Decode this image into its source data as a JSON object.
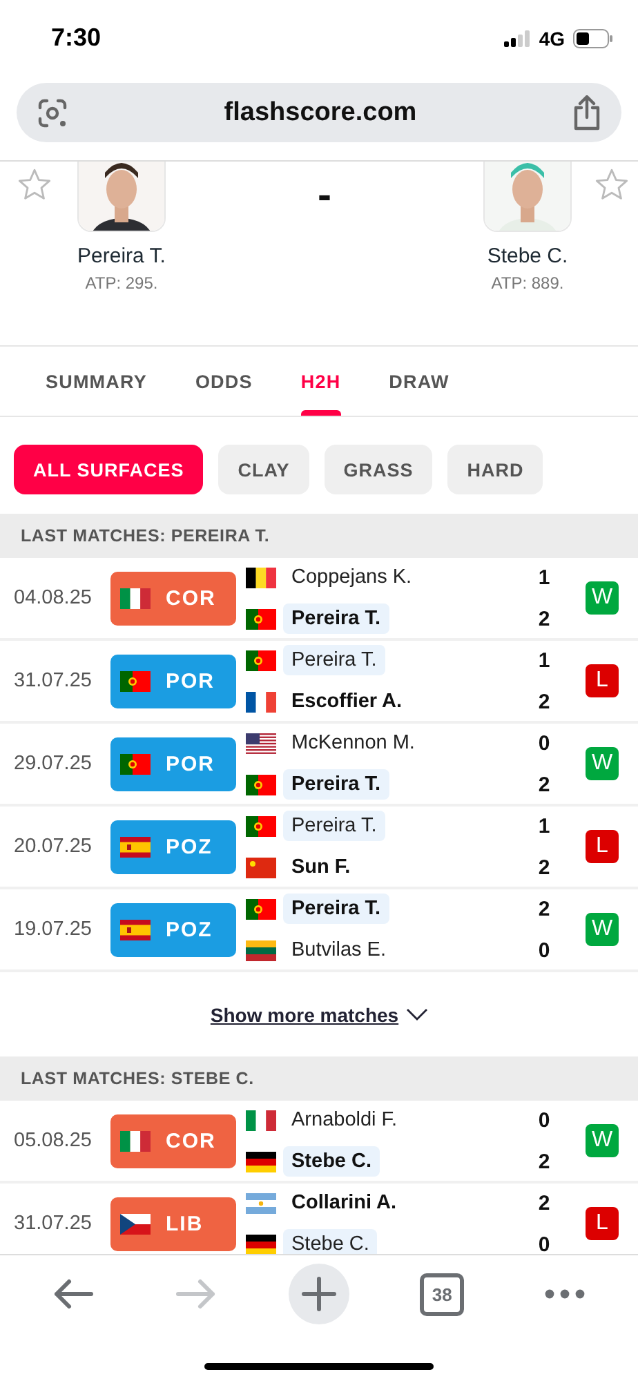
{
  "status_bar": {
    "time": "7:30",
    "network": "4G"
  },
  "address_bar": {
    "url": "flashscore.com"
  },
  "match": {
    "score": "-",
    "players": [
      {
        "name": "Pereira T.",
        "rank": "ATP: 295.",
        "favorite": false
      },
      {
        "name": "Stebe C.",
        "rank": "ATP: 889.",
        "favorite": false
      }
    ]
  },
  "tabs": [
    {
      "label": "SUMMARY",
      "selected": false
    },
    {
      "label": "ODDS",
      "selected": false
    },
    {
      "label": "H2H",
      "selected": true
    },
    {
      "label": "DRAW",
      "selected": false
    }
  ],
  "surface_filters": [
    {
      "label": "ALL SURFACES",
      "selected": true
    },
    {
      "label": "CLAY",
      "selected": false
    },
    {
      "label": "GRASS",
      "selected": false
    },
    {
      "label": "HARD",
      "selected": false
    }
  ],
  "sections": [
    {
      "title": "LAST MATCHES: PEREIRA T.",
      "show_more": "Show more matches",
      "rows": [
        {
          "date": "04.08.25",
          "tournament": {
            "code": "COR",
            "kind": "it",
            "color": "#ef6342"
          },
          "players": [
            {
              "name": "Coppejans K.",
              "kind": "be",
              "score": "1",
              "winner": false,
              "highlighted": false
            },
            {
              "name": "Pereira T.",
              "kind": "pt",
              "score": "2",
              "winner": true,
              "highlighted": true
            }
          ],
          "result": {
            "label": "W",
            "color": "#00a83f"
          }
        },
        {
          "date": "31.07.25",
          "tournament": {
            "code": "POR",
            "kind": "pt",
            "color": "#1b9de2"
          },
          "players": [
            {
              "name": "Pereira T.",
              "kind": "pt",
              "score": "1",
              "winner": false,
              "highlighted": true
            },
            {
              "name": "Escoffier A.",
              "kind": "fr",
              "score": "2",
              "winner": true,
              "highlighted": false
            }
          ],
          "result": {
            "label": "L",
            "color": "#dc0000"
          }
        },
        {
          "date": "29.07.25",
          "tournament": {
            "code": "POR",
            "kind": "pt",
            "color": "#1b9de2"
          },
          "players": [
            {
              "name": "McKennon M.",
              "kind": "us",
              "score": "0",
              "winner": false,
              "highlighted": false
            },
            {
              "name": "Pereira T.",
              "kind": "pt",
              "score": "2",
              "winner": true,
              "highlighted": true
            }
          ],
          "result": {
            "label": "W",
            "color": "#00a83f"
          }
        },
        {
          "date": "20.07.25",
          "tournament": {
            "code": "POZ",
            "kind": "es",
            "color": "#1b9de2"
          },
          "players": [
            {
              "name": "Pereira T.",
              "kind": "pt",
              "score": "1",
              "winner": false,
              "highlighted": true
            },
            {
              "name": "Sun F.",
              "kind": "cn",
              "score": "2",
              "winner": true,
              "highlighted": false
            }
          ],
          "result": {
            "label": "L",
            "color": "#dc0000"
          }
        },
        {
          "date": "19.07.25",
          "tournament": {
            "code": "POZ",
            "kind": "es",
            "color": "#1b9de2"
          },
          "players": [
            {
              "name": "Pereira T.",
              "kind": "pt",
              "score": "2",
              "winner": true,
              "highlighted": true
            },
            {
              "name": "Butvilas E.",
              "kind": "lt",
              "score": "0",
              "winner": false,
              "highlighted": false
            }
          ],
          "result": {
            "label": "W",
            "color": "#00a83f"
          }
        }
      ]
    },
    {
      "title": "LAST MATCHES: STEBE C.",
      "rows": [
        {
          "date": "05.08.25",
          "tournament": {
            "code": "COR",
            "kind": "it",
            "color": "#ef6342"
          },
          "players": [
            {
              "name": "Arnaboldi F.",
              "kind": "it",
              "score": "0",
              "winner": false,
              "highlighted": false
            },
            {
              "name": "Stebe C.",
              "kind": "de",
              "score": "2",
              "winner": true,
              "highlighted": true
            }
          ],
          "result": {
            "label": "W",
            "color": "#00a83f"
          }
        },
        {
          "date": "31.07.25",
          "tournament": {
            "code": "LIB",
            "kind": "cz",
            "color": "#ef6342"
          },
          "players": [
            {
              "name": "Collarini A.",
              "kind": "ar",
              "score": "2",
              "winner": true,
              "highlighted": false
            },
            {
              "name": "Stebe C.",
              "kind": "de",
              "score": "0",
              "winner": false,
              "highlighted": true
            }
          ],
          "result": {
            "label": "L",
            "color": "#dc0000"
          }
        }
      ]
    }
  ],
  "toolbar": [
    {
      "kind": "back",
      "disabled": false
    },
    {
      "kind": "forward",
      "disabled": true
    },
    {
      "kind": "new-tab",
      "disabled": false
    },
    {
      "kind": "tabs",
      "label": "38",
      "disabled": false
    },
    {
      "kind": "menu",
      "disabled": false
    }
  ]
}
